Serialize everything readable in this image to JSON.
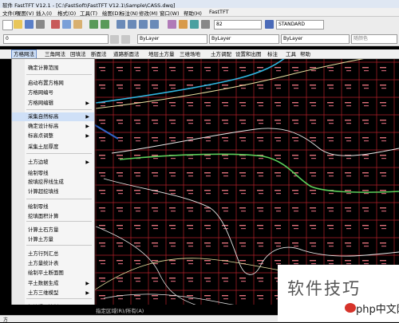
{
  "window": {
    "title": "软件 FastTFT V12.1 - [C:\\FastSoft\\FastTFT V12.1\\Sample\\CASS.dwg]"
  },
  "menubar": [
    "文件(F)",
    "视图(V)",
    "插入(I)",
    "格式(O)",
    "工具(T)",
    "绘图(D)",
    "标注(N)",
    "修改(M)",
    "窗口(W)",
    "帮助(H)",
    "FastTFT"
  ],
  "toolbar": {
    "layer_value": "0",
    "text_style": "STANDARD",
    "layer_combo": "0",
    "linetype": "ByLayer",
    "lineweight": "ByLayer",
    "plotstyle": "ByLayer",
    "color_combo": "随颜色",
    "scale_value": "82"
  },
  "appmenu": [
    "方格网法",
    "三角网法",
    "回填法",
    "断面法",
    "道路断面法",
    "地层土方量",
    "三维场地",
    "土方调配",
    "设置和出图",
    "标注",
    "工具",
    "帮助"
  ],
  "dropdown": {
    "items": [
      {
        "label": "确定计算范围",
        "arrow": false,
        "hl": false
      },
      {
        "label": "启动布置方格网",
        "arrow": false,
        "hl": false
      },
      {
        "label": "方格网编号",
        "arrow": false,
        "hl": false
      },
      {
        "label": "方格网编辑",
        "arrow": true,
        "hl": false
      },
      {
        "label": "采集自然标高",
        "arrow": true,
        "hl": true
      },
      {
        "label": "确定设计标高",
        "arrow": true,
        "hl": false
      },
      {
        "label": "标高点调整",
        "arrow": true,
        "hl": false
      },
      {
        "label": "采集土层厚度",
        "arrow": false,
        "hl": false
      },
      {
        "label": "土方边坡",
        "arrow": true,
        "hl": false
      },
      {
        "label": "绘制零线",
        "arrow": false,
        "hl": false
      },
      {
        "label": "按填挖界线生成",
        "arrow": false,
        "hl": false
      },
      {
        "label": "计算超挖填线",
        "arrow": false,
        "hl": false
      },
      {
        "label": "绘制零线",
        "arrow": false,
        "hl": false
      },
      {
        "label": "挖填面积计算",
        "arrow": false,
        "hl": false
      },
      {
        "label": "计算土石方量",
        "arrow": false,
        "hl": false
      },
      {
        "label": "计算土方量",
        "arrow": false,
        "hl": false
      },
      {
        "label": "土方行列汇总",
        "arrow": false,
        "hl": false
      },
      {
        "label": "土方量统计表",
        "arrow": false,
        "hl": false
      },
      {
        "label": "绘制平土断面图",
        "arrow": false,
        "hl": false
      },
      {
        "label": "平土数据生成",
        "arrow": true,
        "hl": false
      },
      {
        "label": "土方三维模型",
        "arrow": true,
        "hl": false
      },
      {
        "label": "标注提示控制",
        "arrow": false,
        "hl": false
      }
    ]
  },
  "command_line": "指定区域(R)/所有(A)",
  "status_line": "方",
  "watermark": {
    "text": "软件技巧",
    "site": "php中文网"
  },
  "colors": {
    "grid": "#b3202a",
    "curve_green": "#5bd05b",
    "curve_cyan": "#2fb6e0",
    "curve_white": "#e8e8e8",
    "curve_yellow": "#e8e0a0",
    "arrow": "#2f64c8"
  }
}
